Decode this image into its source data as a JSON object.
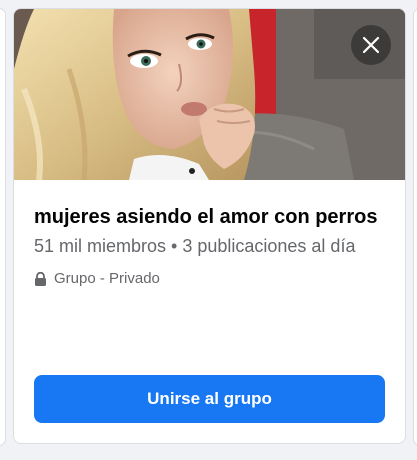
{
  "group_card": {
    "title": "mujeres asiendo el amor con perros",
    "meta": "51 mil miembros • 3 publicaciones al día",
    "privacy": "Grupo - Privado",
    "join_label": "Unirse al grupo",
    "icons": {
      "close": "close-icon",
      "lock": "lock-icon"
    },
    "colors": {
      "accent": "#1877f2",
      "secondary_text": "#65676b"
    }
  }
}
